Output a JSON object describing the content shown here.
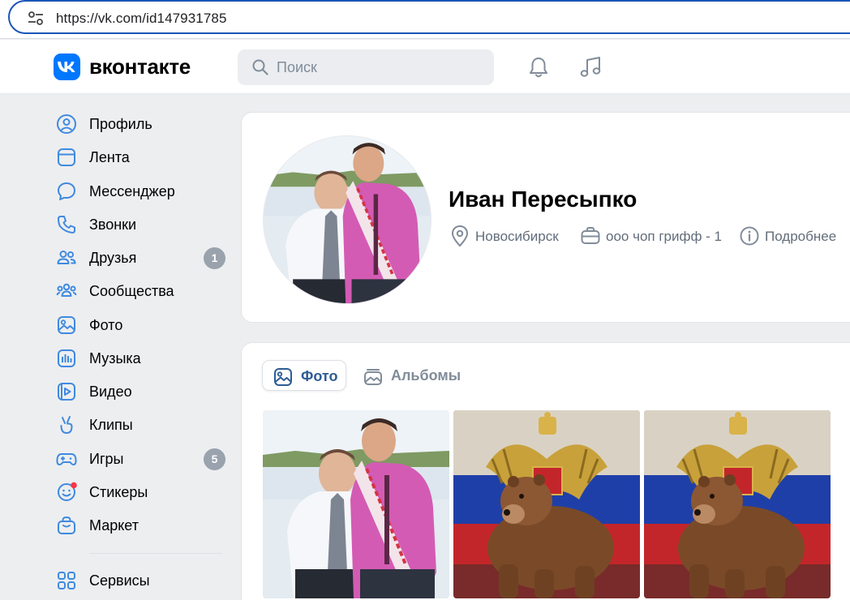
{
  "browser": {
    "url": "https://vk.com/id147931785"
  },
  "header": {
    "brand": "вконтакте",
    "search_placeholder": "Поиск",
    "icons": [
      "notifications-bell-icon",
      "music-note-icon"
    ]
  },
  "sidebar": {
    "items": [
      {
        "label": "Профиль",
        "icon": "profile-icon"
      },
      {
        "label": "Лента",
        "icon": "feed-icon"
      },
      {
        "label": "Мессенджер",
        "icon": "messenger-icon"
      },
      {
        "label": "Звонки",
        "icon": "phone-icon"
      },
      {
        "label": "Друзья",
        "icon": "friends-icon",
        "badge": "1"
      },
      {
        "label": "Сообщества",
        "icon": "communities-icon"
      },
      {
        "label": "Фото",
        "icon": "photo-icon"
      },
      {
        "label": "Музыка",
        "icon": "music-icon"
      },
      {
        "label": "Видео",
        "icon": "video-icon"
      },
      {
        "label": "Клипы",
        "icon": "clips-icon"
      },
      {
        "label": "Игры",
        "icon": "games-icon",
        "badge": "5"
      },
      {
        "label": "Стикеры",
        "icon": "stickers-icon"
      },
      {
        "label": "Маркет",
        "icon": "market-icon"
      },
      {
        "label": "Сервисы",
        "icon": "services-icon"
      }
    ]
  },
  "profile": {
    "name": "Иван Пересыпко",
    "city": "Новосибирск",
    "work": "ооо чоп грифф - 1",
    "more": "Подробнее"
  },
  "photos": {
    "tabs": [
      {
        "label": "Фото",
        "active": true
      },
      {
        "label": "Альбомы",
        "active": false
      }
    ],
    "thumbs": [
      "photo-two-men",
      "photo-bear-eagle-flag",
      "photo-bear-eagle-flag"
    ]
  },
  "colors": {
    "accent": "#0077ff",
    "tab_active": "#2d5c94",
    "badge": "#99a2ad",
    "notification_dot": "#ff3347"
  }
}
